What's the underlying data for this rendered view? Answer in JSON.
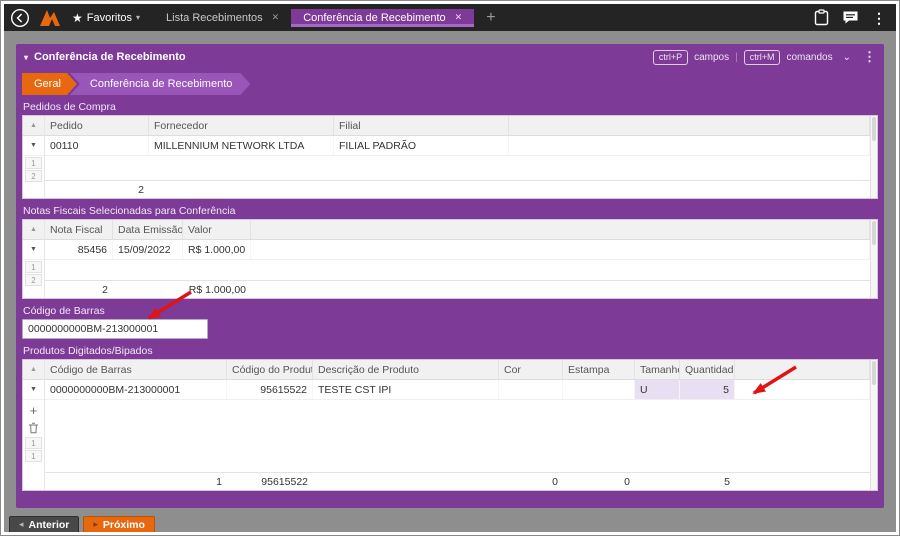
{
  "colors": {
    "topbar-bg": "#242424",
    "purple": "#7d3a96",
    "purple-light": "#9a55b8",
    "orange": "#e8680f",
    "main-bg": "#8e8e8e",
    "arrow-red": "#e01414"
  },
  "icons": {
    "star": "★",
    "menu_chevron": "▾",
    "title_caret": "▾",
    "sort_asc": "▲",
    "row_marker": "▼",
    "close": "✕",
    "add_tab": "+",
    "kebab": "⋮",
    "dropdown_chevron": "⌄",
    "add_row": "+",
    "prev_triangle": "◂",
    "next_triangle": "▸",
    "divider": "|"
  },
  "topbar": {
    "favorites_label": "Favoritos",
    "tabs": [
      {
        "label": "Lista Recebimentos"
      },
      {
        "label": "Conferência de Recebimento"
      }
    ]
  },
  "panel": {
    "title": "Conferência de Recebimento",
    "shortcuts": {
      "key_fields": "ctrl+P",
      "fields_label": "campos",
      "key_commands": "ctrl+M",
      "commands_label": "comandos"
    },
    "breadcrumbs": [
      {
        "label": "Geral"
      },
      {
        "label": "Conferência de Recebimento"
      }
    ]
  },
  "pedidos": {
    "section_title": "Pedidos de Compra",
    "columns": [
      "Pedido",
      "Fornecedor",
      "Filial"
    ],
    "row": {
      "pedido": "00110",
      "fornecedor": "MILLENNIUM NETWORK LTDA",
      "filial": "FILIAL PADRÃO"
    },
    "row_numbers": [
      "1",
      "2"
    ],
    "footer": {
      "count": "2"
    }
  },
  "notas": {
    "section_title": "Notas Fiscais Selecionadas para Conferência",
    "columns": [
      "Nota Fiscal",
      "Data Emissão",
      "Valor"
    ],
    "row": {
      "nota_fiscal": "85456",
      "data_emissao": "15/09/2022",
      "valor": "R$ 1.000,00"
    },
    "row_numbers": [
      "1",
      "2"
    ],
    "footer": {
      "count": "2",
      "total": "R$ 1.000,00"
    }
  },
  "barcode": {
    "label": "Código de Barras",
    "value": "0000000000BM-213000001"
  },
  "produtos": {
    "section_title": "Produtos Digitados/Bipados",
    "columns": [
      "Código de Barras",
      "Código do Produto",
      "Descrição de Produto",
      "Cor",
      "Estampa",
      "Tamanho",
      "Quantidade"
    ],
    "row": {
      "codigo_barras": "0000000000BM-213000001",
      "codigo_produto": "95615522",
      "descricao": "TESTE CST IPI",
      "cor": "",
      "estampa": "",
      "tamanho": "U",
      "quantidade": "5"
    },
    "row_numbers": [
      "1",
      "1"
    ],
    "footer": {
      "count": "1",
      "codigo_produto": "95615522",
      "cor": "0",
      "estampa": "0",
      "quantidade": "5"
    }
  },
  "footer_nav": {
    "previous": "Anterior",
    "next": "Próximo"
  }
}
